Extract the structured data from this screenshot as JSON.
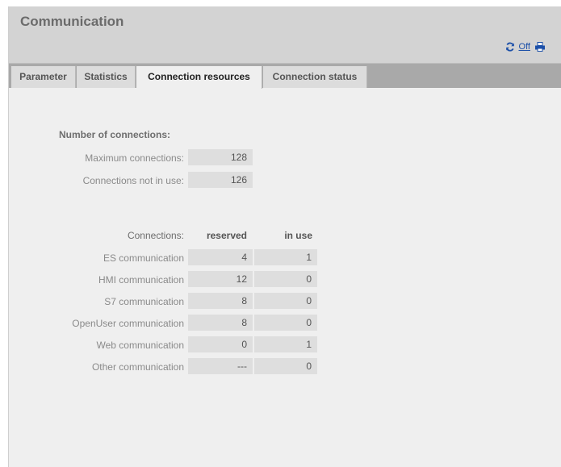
{
  "header": {
    "title": "Communication",
    "off_label": "Off"
  },
  "icons": {
    "refresh": "refresh-icon",
    "print": "print-icon"
  },
  "tabs": [
    {
      "label": "Parameter"
    },
    {
      "label": "Statistics"
    },
    {
      "label": "Connection resources"
    },
    {
      "label": "Connection status"
    }
  ],
  "active_tab": "Connection resources",
  "number_of_connections": {
    "heading": "Number of connections:",
    "rows": [
      {
        "label": "Maximum connections:",
        "value": "128"
      },
      {
        "label": "Connections not in use:",
        "value": "126"
      }
    ]
  },
  "connections": {
    "heading": "Connections:",
    "col_reserved": "reserved",
    "col_in_use": "in use",
    "rows": [
      {
        "label": "ES communication",
        "reserved": "4",
        "in_use": "1"
      },
      {
        "label": "HMI communication",
        "reserved": "12",
        "in_use": "0"
      },
      {
        "label": "S7 communication",
        "reserved": "8",
        "in_use": "0"
      },
      {
        "label": "OpenUser communication",
        "reserved": "8",
        "in_use": "0"
      },
      {
        "label": "Web communication",
        "reserved": "0",
        "in_use": "1"
      },
      {
        "label": "Other communication",
        "reserved": "---",
        "in_use": "0"
      }
    ]
  },
  "colors": {
    "accent_link": "#1b4fa8",
    "tab_bar": "#a9a9a9",
    "header_bg": "#d3d3d3"
  }
}
